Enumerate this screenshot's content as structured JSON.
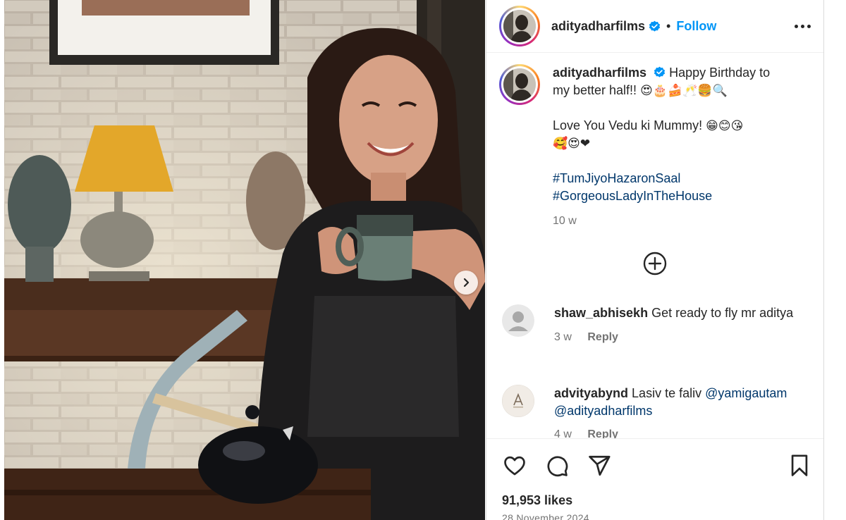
{
  "post": {
    "username": "adityadharfilms",
    "follow_label": "Follow",
    "separator": "•",
    "caption": {
      "line1_text": "Happy Birthday to",
      "line2_text": "my better half!!",
      "line2_emoji": "😍🎂🍰🥂🍔🔍",
      "line3_text": "Love You Vedu ki Mummy!",
      "line3_emoji": "😁😊😘",
      "line4_emoji": "🥰😍❤",
      "hashtag1": "#TumJiyoHazaronSaal",
      "hashtag2": "#GorgeousLadyInTheHouse",
      "time": "10 w"
    },
    "comments": [
      {
        "username": "shaw_abhisekh",
        "text": "Get ready to fly mr aditya",
        "time": "3 w",
        "reply_label": "Reply"
      },
      {
        "username": "advityabynd",
        "text": "Lasiv te faliv",
        "mention1": "@yamigautam",
        "mention2": "@adityadharfilms",
        "time": "4 w",
        "reply_label": "Reply"
      }
    ],
    "likes": "91,953 likes",
    "date": "28 November 2024"
  },
  "icons": {
    "verified": "verified-badge-icon",
    "more": "more-options-icon",
    "add_comment": "add-circle-icon",
    "like": "heart-icon",
    "comment": "comment-bubble-icon",
    "share": "paper-plane-icon",
    "save": "bookmark-icon",
    "next": "chevron-right-icon"
  },
  "colors": {
    "accent": "#0095f6",
    "verified": "#0095f6",
    "hashtag": "#00376b",
    "muted": "#737373",
    "text": "#262626"
  }
}
